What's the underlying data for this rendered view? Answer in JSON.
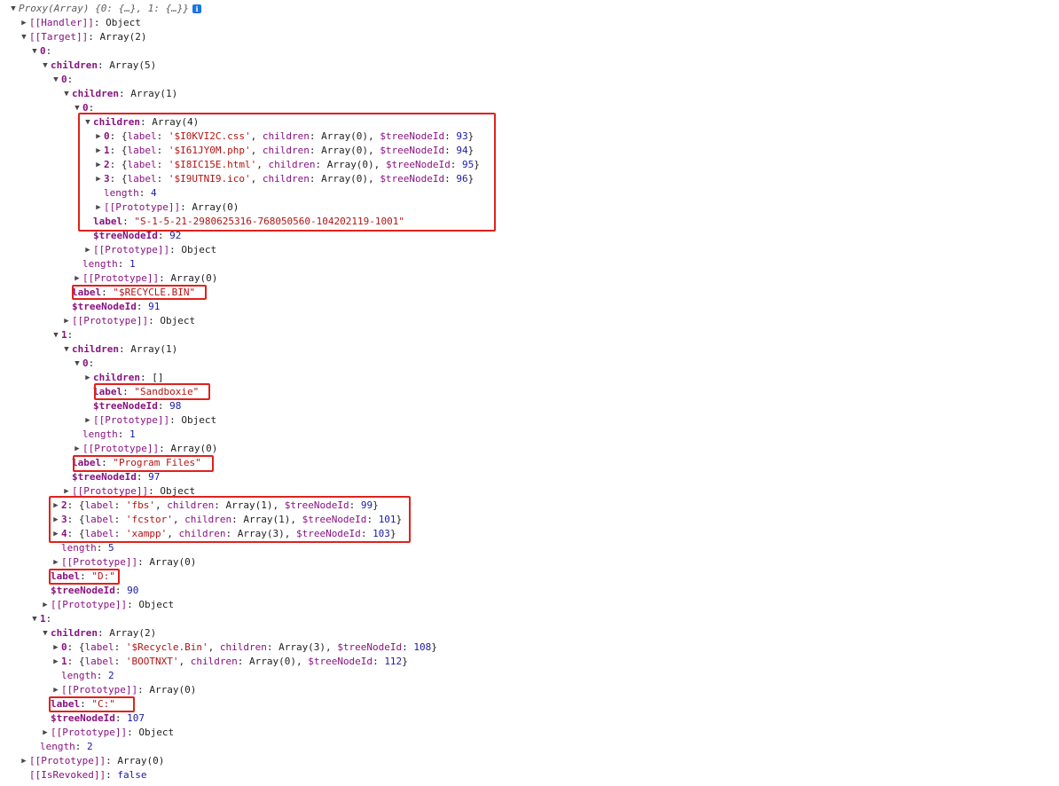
{
  "colors": {
    "key": "#881280",
    "string": "#b31412",
    "number": "#1a1aa6",
    "highlight": "#e0211b"
  },
  "rows": [
    {
      "d": 0,
      "t": "open",
      "k": "",
      "kc": "it",
      "v": [
        [
          "it",
          "Proxy(Array) {0: {…}, 1: {…}}"
        ]
      ],
      "info": true
    },
    {
      "d": 1,
      "t": "closed",
      "k": "[[Handler]]",
      "kc": "k",
      "v": [
        [
          "p",
          "Object"
        ]
      ]
    },
    {
      "d": 1,
      "t": "open",
      "k": "[[Target]]",
      "kc": "k",
      "v": [
        [
          "p",
          "Array(2)"
        ]
      ]
    },
    {
      "d": 2,
      "t": "open",
      "k": "0",
      "kc": "kb",
      "v": []
    },
    {
      "d": 3,
      "t": "open",
      "k": "children",
      "kc": "kb",
      "v": [
        [
          "p",
          "Array(5)"
        ]
      ]
    },
    {
      "d": 4,
      "t": "open",
      "k": "0",
      "kc": "kb",
      "v": []
    },
    {
      "d": 5,
      "t": "open",
      "k": "children",
      "kc": "kb",
      "v": [
        [
          "p",
          "Array(1)"
        ]
      ]
    },
    {
      "d": 6,
      "t": "open",
      "k": "0",
      "kc": "kb",
      "v": []
    },
    {
      "d": 7,
      "t": "open",
      "k": "children",
      "kc": "kb",
      "v": [
        [
          "p",
          "Array(4)"
        ]
      ]
    },
    {
      "d": 8,
      "t": "closed",
      "k": "0",
      "kc": "kb",
      "v": [
        [
          "p",
          "{"
        ],
        [
          "k",
          "label"
        ],
        [
          "p",
          ": "
        ],
        [
          "s",
          "'$I0KVI2C.css'"
        ],
        [
          "p",
          ", "
        ],
        [
          "k",
          "children"
        ],
        [
          "p",
          ": Array(0), "
        ],
        [
          "k",
          "$treeNodeId"
        ],
        [
          "p",
          ": "
        ],
        [
          "n",
          "93"
        ],
        [
          "p",
          "}"
        ]
      ]
    },
    {
      "d": 8,
      "t": "closed",
      "k": "1",
      "kc": "kb",
      "v": [
        [
          "p",
          "{"
        ],
        [
          "k",
          "label"
        ],
        [
          "p",
          ": "
        ],
        [
          "s",
          "'$I61JY0M.php'"
        ],
        [
          "p",
          ", "
        ],
        [
          "k",
          "children"
        ],
        [
          "p",
          ": Array(0), "
        ],
        [
          "k",
          "$treeNodeId"
        ],
        [
          "p",
          ": "
        ],
        [
          "n",
          "94"
        ],
        [
          "p",
          "}"
        ]
      ]
    },
    {
      "d": 8,
      "t": "closed",
      "k": "2",
      "kc": "kb",
      "v": [
        [
          "p",
          "{"
        ],
        [
          "k",
          "label"
        ],
        [
          "p",
          ": "
        ],
        [
          "s",
          "'$I8IC15E.html'"
        ],
        [
          "p",
          ", "
        ],
        [
          "k",
          "children"
        ],
        [
          "p",
          ": Array(0), "
        ],
        [
          "k",
          "$treeNodeId"
        ],
        [
          "p",
          ": "
        ],
        [
          "n",
          "95"
        ],
        [
          "p",
          "}"
        ]
      ]
    },
    {
      "d": 8,
      "t": "closed",
      "k": "3",
      "kc": "kb",
      "v": [
        [
          "p",
          "{"
        ],
        [
          "k",
          "label"
        ],
        [
          "p",
          ": "
        ],
        [
          "s",
          "'$I9UTNI9.ico'"
        ],
        [
          "p",
          ", "
        ],
        [
          "k",
          "children"
        ],
        [
          "p",
          ": Array(0), "
        ],
        [
          "k",
          "$treeNodeId"
        ],
        [
          "p",
          ": "
        ],
        [
          "n",
          "96"
        ],
        [
          "p",
          "}"
        ]
      ]
    },
    {
      "d": 8,
      "t": "leaf",
      "k": "length",
      "kc": "k",
      "v": [
        [
          "n",
          "4"
        ]
      ]
    },
    {
      "d": 8,
      "t": "closed",
      "k": "[[Prototype]]",
      "kc": "k",
      "v": [
        [
          "p",
          "Array(0)"
        ]
      ]
    },
    {
      "d": 7,
      "t": "leaf",
      "k": "label",
      "kc": "kb",
      "v": [
        [
          "s",
          "\"S-1-5-21-2980625316-768050560-104202119-1001\""
        ]
      ]
    },
    {
      "d": 7,
      "t": "leaf",
      "k": "$treeNodeId",
      "kc": "kb",
      "v": [
        [
          "n",
          "92"
        ]
      ]
    },
    {
      "d": 7,
      "t": "closed",
      "k": "[[Prototype]]",
      "kc": "k",
      "v": [
        [
          "p",
          "Object"
        ]
      ]
    },
    {
      "d": 6,
      "t": "leaf",
      "k": "length",
      "kc": "k",
      "v": [
        [
          "n",
          "1"
        ]
      ]
    },
    {
      "d": 6,
      "t": "closed",
      "k": "[[Prototype]]",
      "kc": "k",
      "v": [
        [
          "p",
          "Array(0)"
        ]
      ]
    },
    {
      "d": 5,
      "t": "leaf",
      "k": "label",
      "kc": "kb",
      "v": [
        [
          "s",
          "\"$RECYCLE.BIN\""
        ]
      ]
    },
    {
      "d": 5,
      "t": "leaf",
      "k": "$treeNodeId",
      "kc": "kb",
      "v": [
        [
          "n",
          "91"
        ]
      ]
    },
    {
      "d": 5,
      "t": "closed",
      "k": "[[Prototype]]",
      "kc": "k",
      "v": [
        [
          "p",
          "Object"
        ]
      ]
    },
    {
      "d": 4,
      "t": "open",
      "k": "1",
      "kc": "kb",
      "v": []
    },
    {
      "d": 5,
      "t": "open",
      "k": "children",
      "kc": "kb",
      "v": [
        [
          "p",
          "Array(1)"
        ]
      ]
    },
    {
      "d": 6,
      "t": "open",
      "k": "0",
      "kc": "kb",
      "v": []
    },
    {
      "d": 7,
      "t": "closed",
      "k": "children",
      "kc": "kb",
      "v": [
        [
          "p",
          "[]"
        ]
      ]
    },
    {
      "d": 7,
      "t": "leaf",
      "k": "label",
      "kc": "kb",
      "v": [
        [
          "s",
          "\"Sandboxie\""
        ]
      ]
    },
    {
      "d": 7,
      "t": "leaf",
      "k": "$treeNodeId",
      "kc": "kb",
      "v": [
        [
          "n",
          "98"
        ]
      ]
    },
    {
      "d": 7,
      "t": "closed",
      "k": "[[Prototype]]",
      "kc": "k",
      "v": [
        [
          "p",
          "Object"
        ]
      ]
    },
    {
      "d": 6,
      "t": "leaf",
      "k": "length",
      "kc": "k",
      "v": [
        [
          "n",
          "1"
        ]
      ]
    },
    {
      "d": 6,
      "t": "closed",
      "k": "[[Prototype]]",
      "kc": "k",
      "v": [
        [
          "p",
          "Array(0)"
        ]
      ]
    },
    {
      "d": 5,
      "t": "leaf",
      "k": "label",
      "kc": "kb",
      "v": [
        [
          "s",
          "\"Program Files\""
        ]
      ]
    },
    {
      "d": 5,
      "t": "leaf",
      "k": "$treeNodeId",
      "kc": "kb",
      "v": [
        [
          "n",
          "97"
        ]
      ]
    },
    {
      "d": 5,
      "t": "closed",
      "k": "[[Prototype]]",
      "kc": "k",
      "v": [
        [
          "p",
          "Object"
        ]
      ]
    },
    {
      "d": 4,
      "t": "closed",
      "k": "2",
      "kc": "kb",
      "v": [
        [
          "p",
          "{"
        ],
        [
          "k",
          "label"
        ],
        [
          "p",
          ": "
        ],
        [
          "s",
          "'fbs'"
        ],
        [
          "p",
          ", "
        ],
        [
          "k",
          "children"
        ],
        [
          "p",
          ": Array(1), "
        ],
        [
          "k",
          "$treeNodeId"
        ],
        [
          "p",
          ": "
        ],
        [
          "n",
          "99"
        ],
        [
          "p",
          "}"
        ]
      ]
    },
    {
      "d": 4,
      "t": "closed",
      "k": "3",
      "kc": "kb",
      "v": [
        [
          "p",
          "{"
        ],
        [
          "k",
          "label"
        ],
        [
          "p",
          ": "
        ],
        [
          "s",
          "'fcstor'"
        ],
        [
          "p",
          ", "
        ],
        [
          "k",
          "children"
        ],
        [
          "p",
          ": Array(1), "
        ],
        [
          "k",
          "$treeNodeId"
        ],
        [
          "p",
          ": "
        ],
        [
          "n",
          "101"
        ],
        [
          "p",
          "}"
        ]
      ]
    },
    {
      "d": 4,
      "t": "closed",
      "k": "4",
      "kc": "kb",
      "v": [
        [
          "p",
          "{"
        ],
        [
          "k",
          "label"
        ],
        [
          "p",
          ": "
        ],
        [
          "s",
          "'xampp'"
        ],
        [
          "p",
          ", "
        ],
        [
          "k",
          "children"
        ],
        [
          "p",
          ": Array(3), "
        ],
        [
          "k",
          "$treeNodeId"
        ],
        [
          "p",
          ": "
        ],
        [
          "n",
          "103"
        ],
        [
          "p",
          "}"
        ]
      ]
    },
    {
      "d": 4,
      "t": "leaf",
      "k": "length",
      "kc": "k",
      "v": [
        [
          "n",
          "5"
        ]
      ]
    },
    {
      "d": 4,
      "t": "closed",
      "k": "[[Prototype]]",
      "kc": "k",
      "v": [
        [
          "p",
          "Array(0)"
        ]
      ]
    },
    {
      "d": 3,
      "t": "leaf",
      "k": "label",
      "kc": "kb",
      "v": [
        [
          "s",
          "\"D:\""
        ]
      ]
    },
    {
      "d": 3,
      "t": "leaf",
      "k": "$treeNodeId",
      "kc": "kb",
      "v": [
        [
          "n",
          "90"
        ]
      ]
    },
    {
      "d": 3,
      "t": "closed",
      "k": "[[Prototype]]",
      "kc": "k",
      "v": [
        [
          "p",
          "Object"
        ]
      ]
    },
    {
      "d": 2,
      "t": "open",
      "k": "1",
      "kc": "kb",
      "v": []
    },
    {
      "d": 3,
      "t": "open",
      "k": "children",
      "kc": "kb",
      "v": [
        [
          "p",
          "Array(2)"
        ]
      ]
    },
    {
      "d": 4,
      "t": "closed",
      "k": "0",
      "kc": "kb",
      "v": [
        [
          "p",
          "{"
        ],
        [
          "k",
          "label"
        ],
        [
          "p",
          ": "
        ],
        [
          "s",
          "'$Recycle.Bin'"
        ],
        [
          "p",
          ", "
        ],
        [
          "k",
          "children"
        ],
        [
          "p",
          ": Array(3), "
        ],
        [
          "k",
          "$treeNodeId"
        ],
        [
          "p",
          ": "
        ],
        [
          "n",
          "108"
        ],
        [
          "p",
          "}"
        ]
      ]
    },
    {
      "d": 4,
      "t": "closed",
      "k": "1",
      "kc": "kb",
      "v": [
        [
          "p",
          "{"
        ],
        [
          "k",
          "label"
        ],
        [
          "p",
          ": "
        ],
        [
          "s",
          "'BOOTNXT'"
        ],
        [
          "p",
          ", "
        ],
        [
          "k",
          "children"
        ],
        [
          "p",
          ": Array(0), "
        ],
        [
          "k",
          "$treeNodeId"
        ],
        [
          "p",
          ": "
        ],
        [
          "n",
          "112"
        ],
        [
          "p",
          "}"
        ]
      ]
    },
    {
      "d": 4,
      "t": "leaf",
      "k": "length",
      "kc": "k",
      "v": [
        [
          "n",
          "2"
        ]
      ]
    },
    {
      "d": 4,
      "t": "closed",
      "k": "[[Prototype]]",
      "kc": "k",
      "v": [
        [
          "p",
          "Array(0)"
        ]
      ]
    },
    {
      "d": 3,
      "t": "leaf",
      "k": "label",
      "kc": "kb",
      "v": [
        [
          "s",
          "\"C:\""
        ]
      ]
    },
    {
      "d": 3,
      "t": "leaf",
      "k": "$treeNodeId",
      "kc": "kb",
      "v": [
        [
          "n",
          "107"
        ]
      ]
    },
    {
      "d": 3,
      "t": "closed",
      "k": "[[Prototype]]",
      "kc": "k",
      "v": [
        [
          "p",
          "Object"
        ]
      ]
    },
    {
      "d": 2,
      "t": "leaf",
      "k": "length",
      "kc": "k",
      "v": [
        [
          "n",
          "2"
        ]
      ]
    },
    {
      "d": 1,
      "t": "closed",
      "k": "[[Prototype]]",
      "kc": "k",
      "v": [
        [
          "p",
          "Array(0)"
        ]
      ]
    },
    {
      "d": 1,
      "t": "leaf",
      "k": "[[IsRevoked]]",
      "kc": "k",
      "v": [
        [
          "n",
          "false"
        ]
      ]
    }
  ]
}
